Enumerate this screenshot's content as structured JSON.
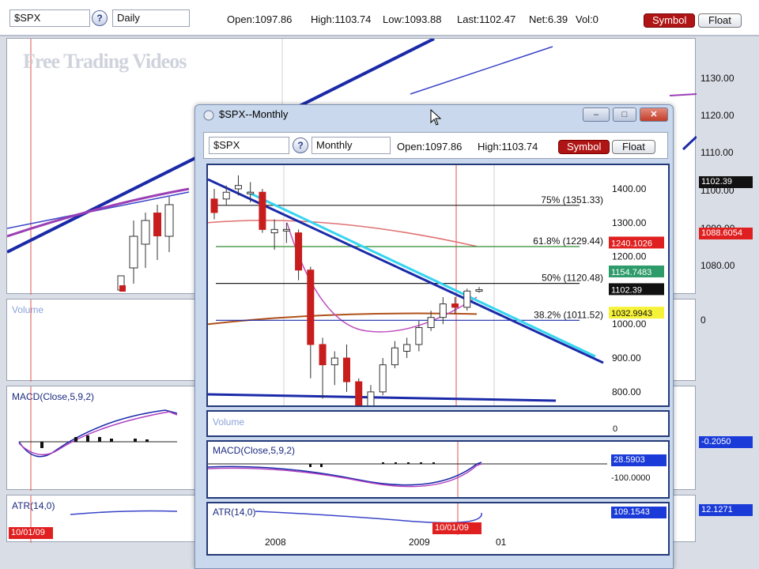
{
  "main": {
    "symbol": "$SPX",
    "help_icon": "?",
    "period": "Daily",
    "quotes": {
      "open": "Open:1097.86",
      "high": "High:1103.74",
      "low": "Low:1093.88",
      "last": "Last:1102.47",
      "net": "Net:6.39",
      "vol": "Vol:0"
    },
    "symbol_button": "Symbol",
    "float_button": "Float",
    "watermark": "Free Trading Videos",
    "price_ticks": [
      "1130.00",
      "1120.00",
      "1110.00",
      "1100.00",
      "1090.00",
      "1080.00"
    ],
    "last_tag": "1102.39",
    "red_tag": "1088.6054",
    "volume_label": "Volume",
    "volume_value": "0",
    "macd_label": "MACD(Close,5,9,2)",
    "macd_value": "-0.2050",
    "atr_label": "ATR(14,0)",
    "atr_value": "12.1271",
    "date_tag": "10/01/09"
  },
  "window": {
    "title": "$SPX--Monthly",
    "symbol": "$SPX",
    "help_icon": "?",
    "period": "Monthly",
    "open": "Open:1097.86",
    "high": "High:1103.74",
    "symbol_button": "Symbol",
    "float_button": "Float",
    "volume_label": "Volume",
    "volume_value": "0",
    "macd_label": "MACD(Close,5,9,2)",
    "macd_value": "28.5903",
    "macd_axis": "-100.0000",
    "atr_label": "ATR(14,0)",
    "atr_value": "109.1543",
    "date_tag": "10/01/09",
    "x_labels": [
      "2008",
      "2009",
      "01"
    ],
    "price_tags": {
      "red": "1240.1026",
      "green": "1154.7483",
      "last": "1102.39",
      "yellow": "1032.9943"
    }
  },
  "chart_data": {
    "type": "candlestick",
    "y_ticks": [
      1400,
      1300,
      1200,
      1100,
      1000,
      900,
      800
    ],
    "ylim": [
      760,
      1470
    ],
    "fib_levels": [
      {
        "label": "75% (1351.33)",
        "value": 1351.33,
        "color": "#222222"
      },
      {
        "label": "61.8% (1229.44)",
        "value": 1229.44,
        "color": "#2e8b2e"
      },
      {
        "label": "50% (1120.48)",
        "value": 1120.48,
        "color": "#222222"
      },
      {
        "label": "38.2% (1011.52)",
        "value": 1011.52,
        "color": "#1a2aa8"
      }
    ],
    "candles": [
      {
        "o": 1370,
        "c": 1330,
        "h": 1400,
        "l": 1310
      },
      {
        "o": 1370,
        "c": 1390,
        "h": 1410,
        "l": 1350
      },
      {
        "o": 1400,
        "c": 1410,
        "h": 1440,
        "l": 1380
      },
      {
        "o": 1390,
        "c": 1390,
        "h": 1420,
        "l": 1360
      },
      {
        "o": 1390,
        "c": 1280,
        "h": 1400,
        "l": 1270
      },
      {
        "o": 1270,
        "c": 1280,
        "h": 1310,
        "l": 1220
      },
      {
        "o": 1280,
        "c": 1280,
        "h": 1300,
        "l": 1240
      },
      {
        "o": 1270,
        "c": 1160,
        "h": 1280,
        "l": 1130
      },
      {
        "o": 1160,
        "c": 940,
        "h": 1170,
        "l": 840
      },
      {
        "o": 940,
        "c": 880,
        "h": 960,
        "l": 780
      },
      {
        "o": 880,
        "c": 900,
        "h": 920,
        "l": 820
      },
      {
        "o": 900,
        "c": 830,
        "h": 940,
        "l": 800
      },
      {
        "o": 830,
        "c": 740,
        "h": 840,
        "l": 730
      },
      {
        "o": 740,
        "c": 800,
        "h": 820,
        "l": 680
      },
      {
        "o": 800,
        "c": 880,
        "h": 900,
        "l": 790
      },
      {
        "o": 880,
        "c": 930,
        "h": 950,
        "l": 870
      },
      {
        "o": 920,
        "c": 940,
        "h": 960,
        "l": 900
      },
      {
        "o": 940,
        "c": 990,
        "h": 1010,
        "l": 920
      },
      {
        "o": 990,
        "c": 1020,
        "h": 1040,
        "l": 980
      },
      {
        "o": 1020,
        "c": 1060,
        "h": 1080,
        "l": 1000
      },
      {
        "o": 1060,
        "c": 1050,
        "h": 1080,
        "l": 1030
      },
      {
        "o": 1050,
        "c": 1098,
        "h": 1105,
        "l": 1040
      },
      {
        "o": 1098,
        "c": 1102,
        "h": 1110,
        "l": 1093
      }
    ]
  }
}
